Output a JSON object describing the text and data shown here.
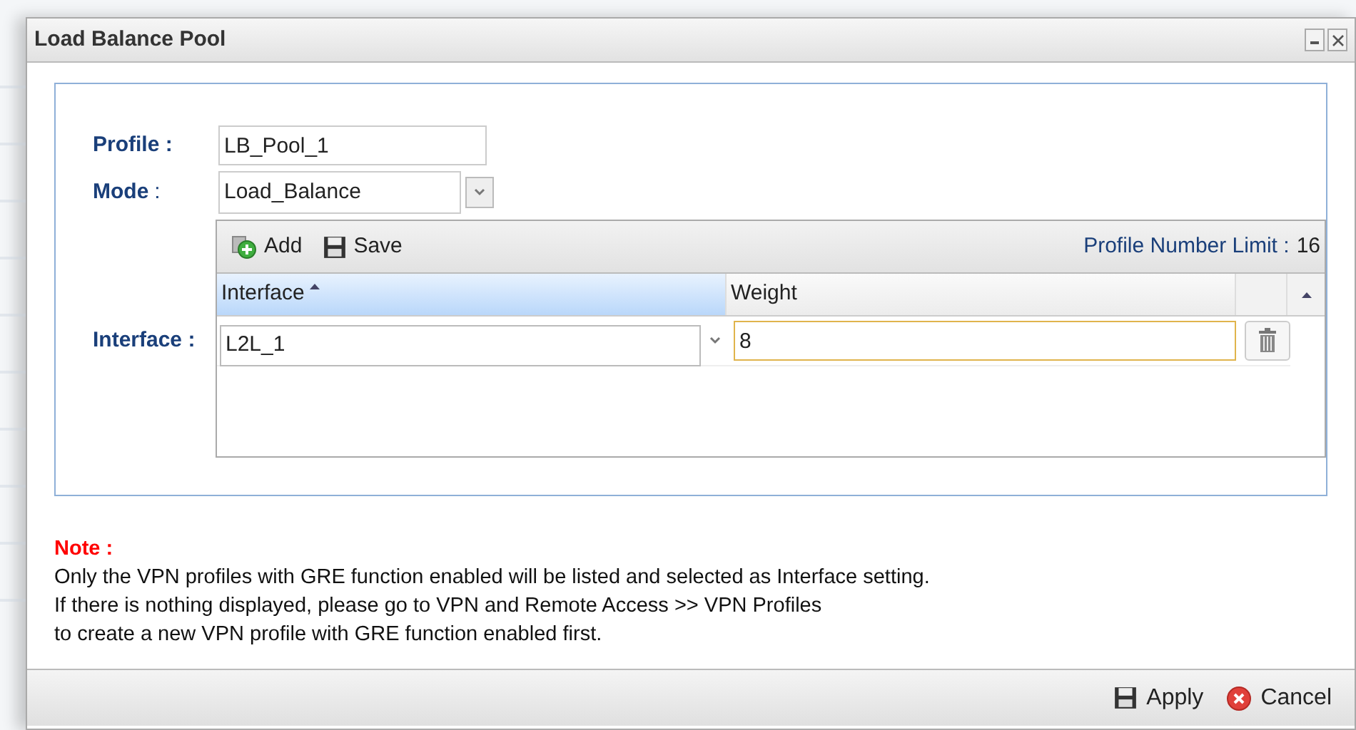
{
  "window": {
    "title": "Load Balance Pool"
  },
  "form": {
    "profile_label": "Profile :",
    "profile_value": "LB_Pool_1",
    "mode_label": "Mode",
    "mode_colon": ":",
    "mode_value": "Load_Balance",
    "interface_label": "Interface :"
  },
  "grid": {
    "toolbar": [
      "Add",
      "Save"
    ],
    "limit_label": "Profile Number Limit :",
    "limit_value": "16",
    "columns": [
      {
        "label": "Interface",
        "sorted": true
      },
      {
        "label": "Weight",
        "sorted": false
      }
    ],
    "rows": [
      {
        "interface": "L2L_1",
        "weight": "8"
      }
    ]
  },
  "note": {
    "title": "Note :",
    "lines": [
      "Only the VPN profiles with GRE function enabled will be listed and selected as Interface setting.",
      "If there is nothing displayed, please go to VPN and Remote Access >> VPN Profiles",
      "to create a new VPN profile with GRE function enabled first."
    ]
  },
  "buttons": [
    {
      "kind": "apply",
      "label": "Apply"
    },
    {
      "kind": "cancel",
      "label": "Cancel"
    }
  ]
}
